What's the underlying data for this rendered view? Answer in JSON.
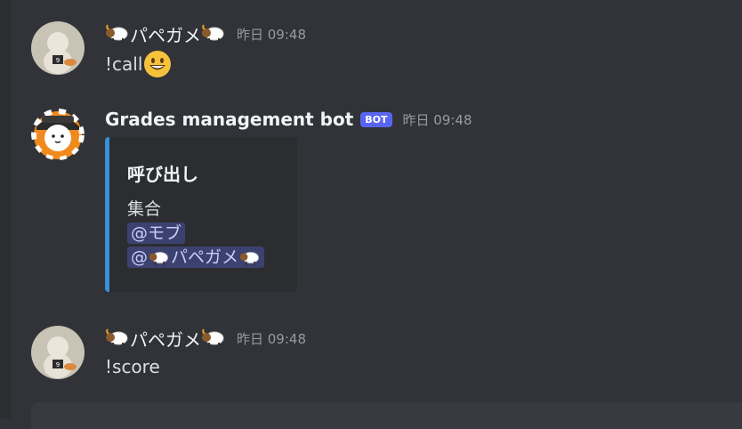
{
  "messages": [
    {
      "username": "パペガメ",
      "timestamp": "昨日 09:48",
      "content": "!call",
      "content_emoji": "smiley-emoji"
    },
    {
      "username": "Grades management bot",
      "bot_tag": "BOT",
      "timestamp": "昨日 09:48",
      "embed": {
        "title": "呼び出し",
        "line1": "集合",
        "mention1": "@モブ",
        "mention2_prefix": "@",
        "mention2_name": "パペガメ"
      }
    },
    {
      "username": "パペガメ",
      "timestamp": "昨日 09:48",
      "content": "!score"
    }
  ],
  "colors": {
    "background": "#313338",
    "embed_accent": "#3592d6",
    "bot_tag": "#5865f2",
    "mention_bg": "#3c4270"
  }
}
